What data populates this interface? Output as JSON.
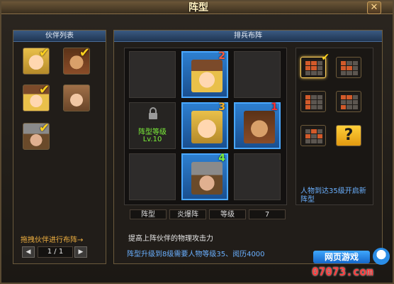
{
  "window": {
    "title": "阵型",
    "close_glyph": "✕"
  },
  "partner_list": {
    "title": "伙伴列表",
    "partners": [
      {
        "portrait": "blonde-girl",
        "deployed": true
      },
      {
        "portrait": "brown-warrior",
        "deployed": true
      },
      {
        "portrait": "blonde-hat-girl",
        "deployed": true
      },
      {
        "portrait": "brown-hair-girl",
        "deployed": false
      },
      {
        "portrait": "helmet-boy",
        "deployed": true
      }
    ],
    "check_glyph": "✔",
    "hint": "拖拽伙伴进行布阵→",
    "pager": {
      "prev": "◀",
      "next": "▶",
      "page": "1 / 1"
    }
  },
  "formation": {
    "title": "排兵布阵",
    "slots": [
      {
        "position": 1,
        "state": "empty"
      },
      {
        "position": 2,
        "state": "occupied",
        "order": "2",
        "order_color": "#ff5a3a",
        "portrait": "blonde-hat-girl"
      },
      {
        "position": 3,
        "state": "empty"
      },
      {
        "position": 4,
        "state": "locked",
        "lock_label": "阵型等级",
        "lock_level": "Lv.10"
      },
      {
        "position": 5,
        "state": "occupied",
        "order": "3",
        "order_color": "#ffb020",
        "portrait": "blonde-girl"
      },
      {
        "position": 6,
        "state": "occupied",
        "order": "1",
        "order_color": "#ff3030",
        "portrait": "brown-warrior"
      },
      {
        "position": 7,
        "state": "empty"
      },
      {
        "position": 8,
        "state": "occupied",
        "order": "4",
        "order_color": "#7cf03a",
        "portrait": "helmet-boy"
      },
      {
        "position": 9,
        "state": "empty"
      }
    ],
    "info": {
      "formation_label": "阵型",
      "formation_value": "炎爆阵",
      "level_label": "等级",
      "level_value": "7"
    },
    "effect": "提高上阵伙伴的物理攻击力",
    "upgrade_hint": "阵型升级到8级需要人物等级35、阅历4000"
  },
  "formation_picker": {
    "options": [
      {
        "selected": true,
        "cells": [
          1,
          1,
          0,
          1,
          1,
          0,
          0,
          0,
          0
        ]
      },
      {
        "selected": false,
        "cells": [
          1,
          0,
          0,
          1,
          1,
          0,
          0,
          0,
          0
        ]
      },
      {
        "selected": false,
        "cells": [
          1,
          0,
          0,
          1,
          0,
          0,
          1,
          0,
          0
        ]
      },
      {
        "selected": false,
        "cells": [
          1,
          1,
          0,
          0,
          0,
          0,
          1,
          0,
          0
        ]
      },
      {
        "selected": false,
        "cells": [
          0,
          1,
          0,
          1,
          0,
          1,
          0,
          0,
          0
        ]
      },
      {
        "selected": false,
        "locked": true,
        "label": "?"
      }
    ],
    "unlock_hint": "人物到达35级开启新阵型"
  },
  "watermark": {
    "line1": "网页游戏",
    "line2": "07073.com"
  },
  "colors": {
    "accent_blue": "#2d7fd0",
    "gold": "#ffd21e",
    "hint_blue": "#6ab0ff",
    "hint_orange": "#f0b040"
  }
}
